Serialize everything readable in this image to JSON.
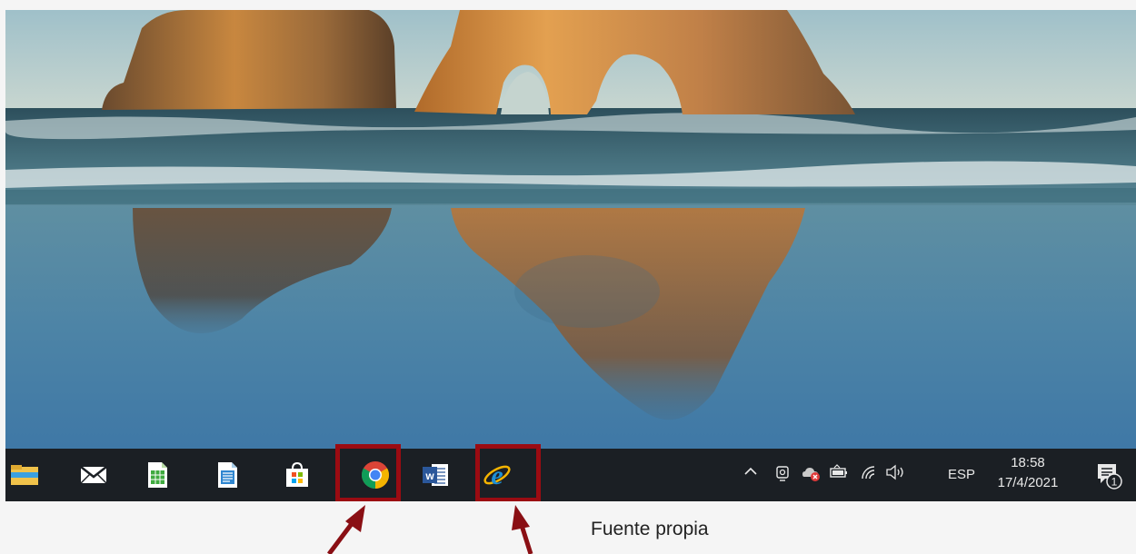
{
  "taskbar": {
    "apps": [
      {
        "name": "file-explorer",
        "icon": "folder-icon"
      },
      {
        "name": "mail",
        "icon": "mail-icon"
      },
      {
        "name": "calc",
        "icon": "spreadsheet-icon"
      },
      {
        "name": "writer",
        "icon": "document-icon"
      },
      {
        "name": "store",
        "icon": "store-bag-icon"
      },
      {
        "name": "chrome",
        "icon": "chrome-icon",
        "highlighted": true
      },
      {
        "name": "word",
        "icon": "word-icon"
      },
      {
        "name": "internet-explorer",
        "icon": "internet-explorer-icon",
        "highlighted": true
      }
    ],
    "tray": {
      "icons": [
        "chevron-up-icon",
        "meet-now-icon",
        "onedrive-error-icon",
        "battery-icon",
        "wifi-icon",
        "volume-icon"
      ],
      "language": "ESP",
      "time": "18:58",
      "date": "17/4/2021",
      "notification_count": "1"
    }
  },
  "caption": "Fuente propia",
  "colors": {
    "highlight": "#9b0b12",
    "taskbar": "#1b1f24",
    "arrow": "#8a0f14"
  }
}
